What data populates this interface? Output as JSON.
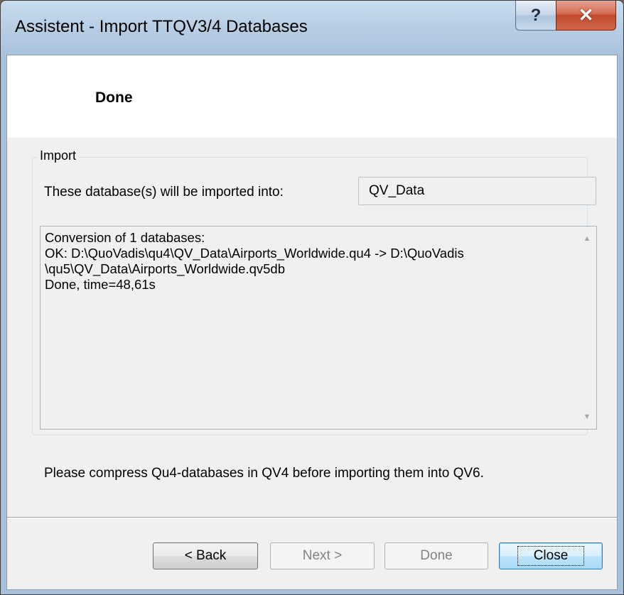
{
  "window": {
    "title": "Assistent - Import TTQV3/4 Databases",
    "help_glyph": "?",
    "close_glyph": "✕"
  },
  "header": {
    "title": "Done"
  },
  "import_group": {
    "label": "Import",
    "target_label": "These database(s) will be imported into:",
    "target_value": "QV_Data",
    "log_lines": [
      "Conversion of 1 databases:",
      "OK: D:\\QuoVadis\\qu4\\QV_Data\\Airports_Worldwide.qu4 -> D:\\QuoVadis",
      "\\qu5\\QV_Data\\Airports_Worldwide.qv5db",
      "Done, time=48,61s"
    ]
  },
  "hint": "Please compress Qu4-databases in QV4 before importing them into QV6.",
  "buttons": {
    "back": "< Back",
    "next": "Next >",
    "done": "Done",
    "close": "Close"
  }
}
